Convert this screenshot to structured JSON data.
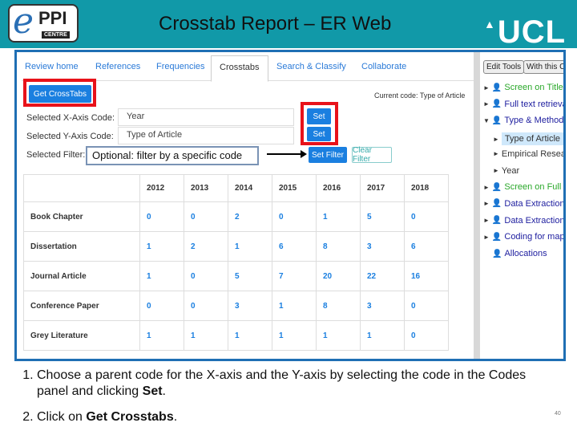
{
  "slide": {
    "title": "Crosstab Report – ER Web",
    "logo_left": "ePPI CENTRE",
    "logo_right": "UCL",
    "page_number": "40",
    "header_color": "#1199a8"
  },
  "tabs": [
    "Review home",
    "References",
    "Frequencies",
    "Crosstabs",
    "Search & Classify",
    "Collaborate"
  ],
  "active_tab": "Crosstabs",
  "form": {
    "get_crosstabs": "Get CrossTabs",
    "current_code": "Current code: Type of Article",
    "x_label": "Selected X-Axis Code:",
    "x_value": "Year",
    "y_label": "Selected Y-Axis Code:",
    "y_value": "Type of Article",
    "filter_label": "Selected Filter:",
    "set": "Set",
    "set_filter": "Set Filter",
    "clear_filter": "Clear Filter"
  },
  "callout": "Optional: filter by a specific code",
  "table": {
    "columns": [
      "2012",
      "2013",
      "2014",
      "2015",
      "2016",
      "2017",
      "2018"
    ],
    "rows": [
      {
        "label": "Book Chapter",
        "values": [
          "0",
          "0",
          "2",
          "0",
          "1",
          "5",
          "0"
        ]
      },
      {
        "label": "Dissertation",
        "values": [
          "1",
          "2",
          "1",
          "6",
          "8",
          "3",
          "6"
        ]
      },
      {
        "label": "Journal Article",
        "values": [
          "1",
          "0",
          "5",
          "7",
          "20",
          "22",
          "16"
        ]
      },
      {
        "label": "Conference Paper",
        "values": [
          "0",
          "0",
          "3",
          "1",
          "8",
          "3",
          "0"
        ]
      },
      {
        "label": "Grey Literature",
        "values": [
          "1",
          "1",
          "1",
          "1",
          "1",
          "1",
          "0"
        ]
      }
    ]
  },
  "codes": {
    "edit_tools": "Edit Tools",
    "with_this": "With this C",
    "items": [
      {
        "label": "Screen on Title &",
        "color": "#2aa82a",
        "icon": "person-icon",
        "arrow": "right",
        "indent": 0
      },
      {
        "label": "Full text retrieval",
        "color": "#2020a0",
        "icon": "person-icon",
        "arrow": "right",
        "indent": 0
      },
      {
        "label": "Type & Method",
        "color": "#2020a0",
        "icon": "person-icon",
        "arrow": "down",
        "indent": 0
      },
      {
        "label": "Type of Article",
        "color": "#333",
        "arrow": "right",
        "indent": 1,
        "selected": true
      },
      {
        "label": "Empirical Resear",
        "color": "#333",
        "arrow": "right",
        "indent": 1
      },
      {
        "label": "Year",
        "color": "#333",
        "arrow": "right",
        "indent": 1
      },
      {
        "label": "Screen on Full Te",
        "color": "#2aa82a",
        "icon": "person-icon",
        "arrow": "right",
        "indent": 0
      },
      {
        "label": "Data Extraction",
        "color": "#2020a0",
        "icon": "person-icon",
        "arrow": "right",
        "indent": 0
      },
      {
        "label": "Data Extraction c",
        "color": "#2020a0",
        "icon": "person-icon",
        "arrow": "right",
        "indent": 0
      },
      {
        "label": "Coding for map",
        "color": "#2020a0",
        "icon": "person-icon",
        "arrow": "right",
        "indent": 0
      },
      {
        "label": "Allocations",
        "color": "#2020a0",
        "icon": "person-icon",
        "arrow": "none",
        "indent": 0
      }
    ]
  },
  "instructions": {
    "step1_pre": "Choose a parent code for the X-axis and the Y-axis by selecting the code in the Codes panel and clicking ",
    "step1_bold": "Set",
    "step2_pre": "Click on ",
    "step2_bold": "Get Crosstabs"
  }
}
